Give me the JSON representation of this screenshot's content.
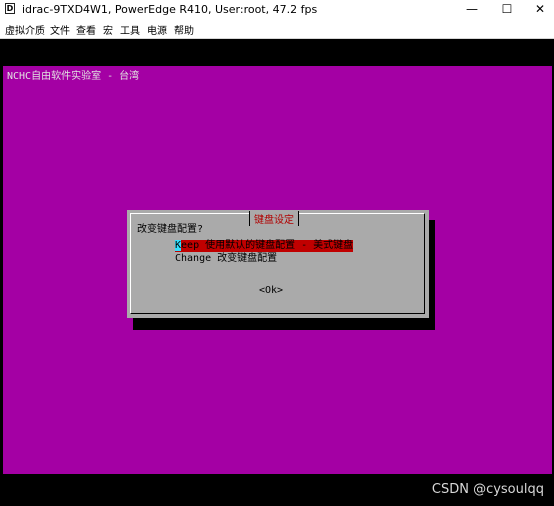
{
  "window": {
    "title": "idrac-9TXD4W1, PowerEdge R410, User:root, 47.2 fps",
    "icon": "console-app-icon",
    "buttons": {
      "minimize": "—",
      "maximize": "☐",
      "close": "✕"
    }
  },
  "menubar": {
    "items": [
      "虚拟介质",
      "文件",
      "查看",
      "宏",
      "工具",
      "电源",
      "帮助"
    ]
  },
  "console": {
    "backtitle": "NCHC自由软件实验室 - 台湾",
    "dialog": {
      "title": "键盘设定",
      "question": "改变键盘配置?",
      "options": [
        {
          "key_first": "K",
          "rest": "eep   使用默认的键盘配置 - 美式键盘",
          "selected": true
        },
        {
          "label": "Change 改变键盘配置",
          "selected": false
        }
      ],
      "ok_button": "<Ok>"
    }
  },
  "watermark": "CSDN @cysoulqq",
  "colors": {
    "console_bg": "#a400a4",
    "dialog_bg": "#aaaaaa",
    "selection": "#c00000",
    "title_red": "#b00000"
  }
}
